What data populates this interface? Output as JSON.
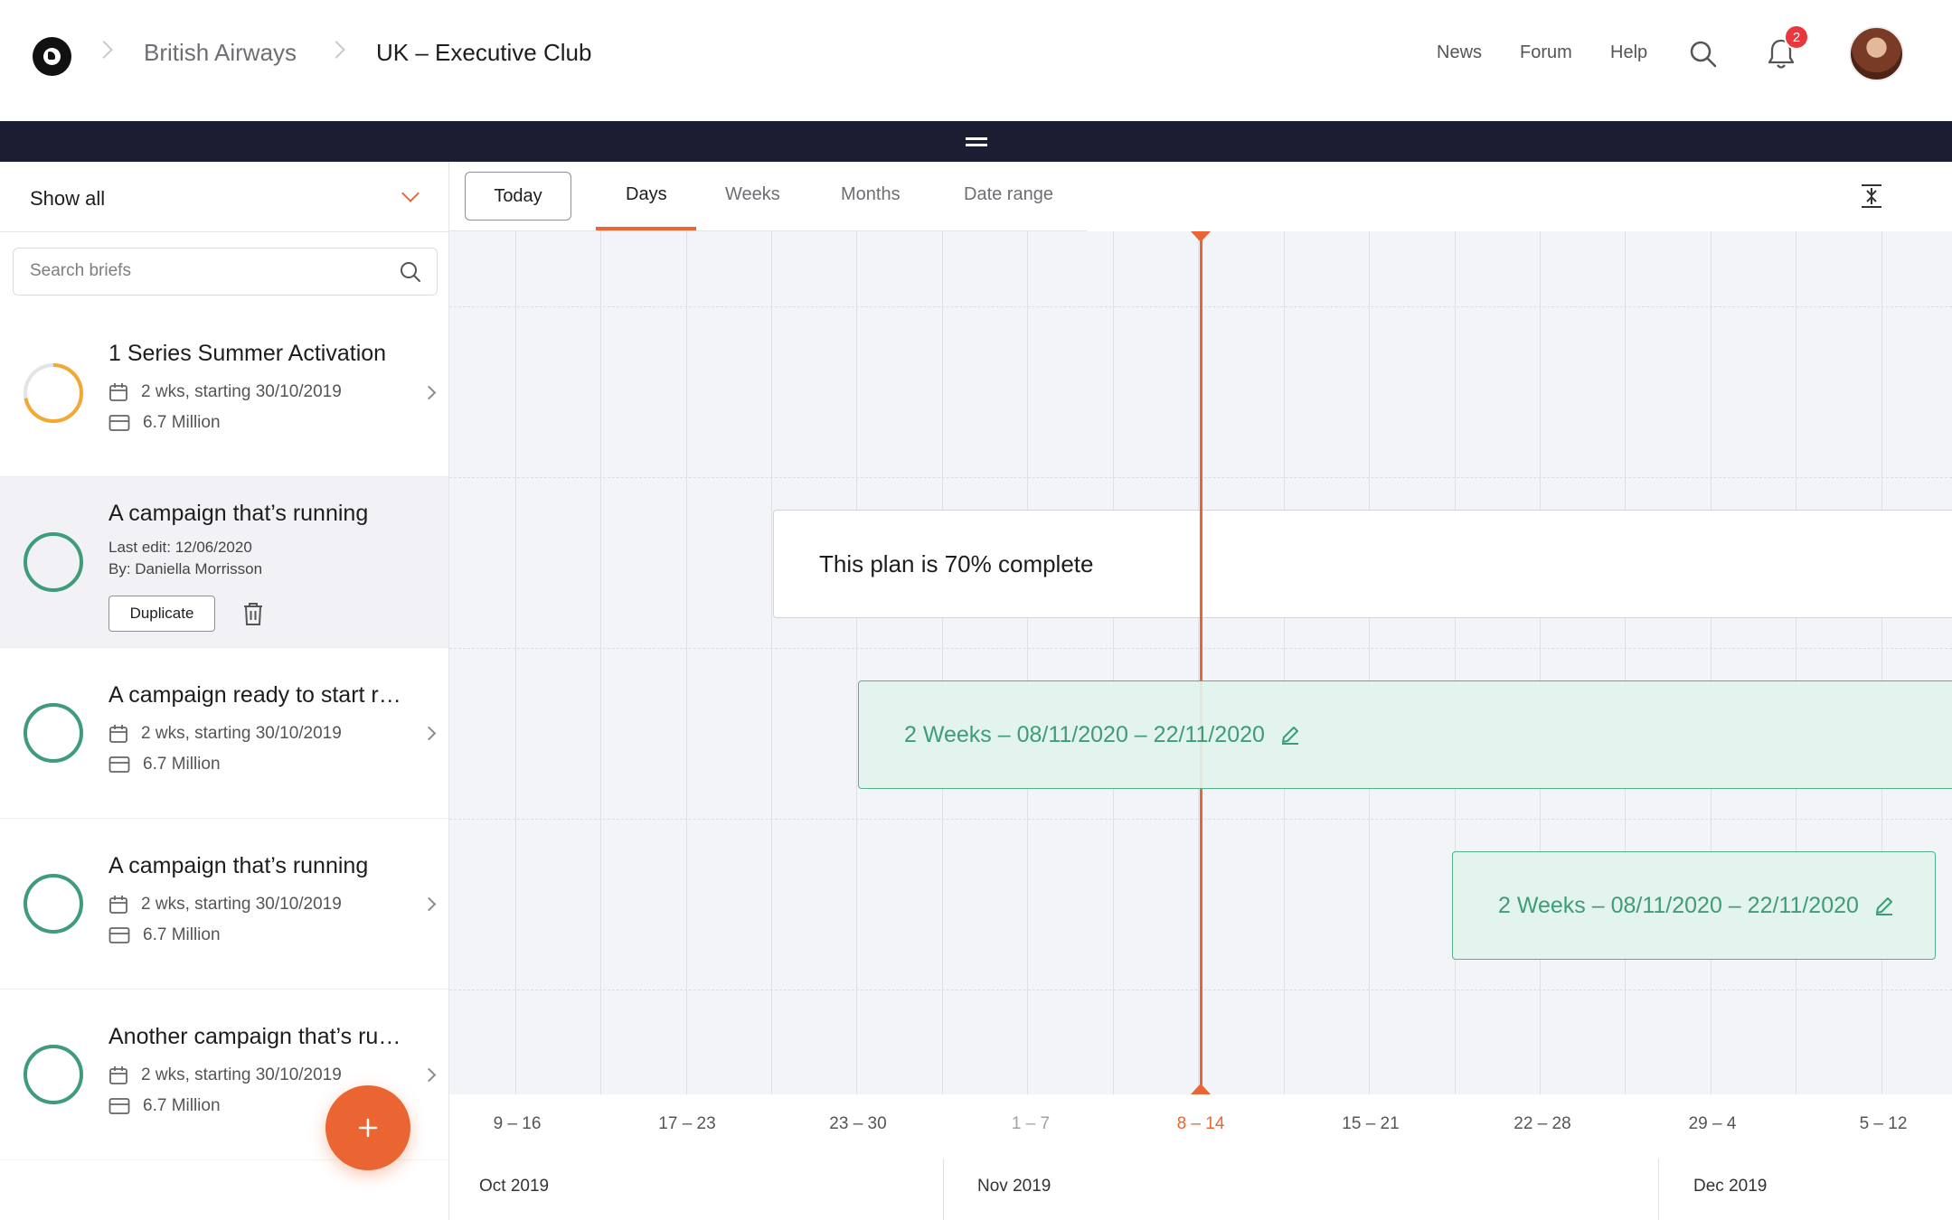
{
  "header": {
    "breadcrumb": [
      "British Airways",
      "UK – Executive Club"
    ],
    "nav": [
      "News",
      "Forum",
      "Help"
    ],
    "notification_count": "2"
  },
  "sidebar": {
    "filter_label": "Show all",
    "search_placeholder": "Search briefs",
    "briefs": [
      {
        "title": "1 Series Summer Activation",
        "duration": "2 wks, starting 30/10/2019",
        "budget": "6.7 Million",
        "progress": 0.72,
        "color": "#f2a833"
      },
      {
        "title": "A campaign that’s running",
        "last_edit": "Last edit: 12/06/2020",
        "by": "By: Daniella Morrisson",
        "duplicate_label": "Duplicate",
        "progress": 1.0,
        "color": "#3e9c78"
      },
      {
        "title": "A campaign ready to start r…",
        "duration": "2 wks, starting 30/10/2019",
        "budget": "6.7 Million",
        "progress": 1.0,
        "color": "#3e9c78"
      },
      {
        "title": "A campaign that’s running",
        "duration": "2 wks, starting 30/10/2019",
        "budget": "6.7 Million",
        "progress": 1.0,
        "color": "#3e9c78"
      },
      {
        "title": "Another campaign that’s ru…",
        "duration": "2 wks, starting 30/10/2019",
        "budget": "6.7 Million",
        "progress": 1.0,
        "color": "#3e9c78"
      }
    ]
  },
  "timeline": {
    "today_label": "Today",
    "tabs": [
      "Days",
      "Weeks",
      "Months",
      "Date range"
    ],
    "active_tab": "Days",
    "plan_text": "This plan is 70% complete",
    "bar_1_text": "2 Weeks – 08/11/2020 – 22/11/2020",
    "bar_2_text": "2 Weeks – 08/11/2020 – 22/11/2020",
    "weeks": [
      "9 – 16",
      "17 – 23",
      "23 – 30",
      "1 – 7",
      "8 – 14",
      "15 – 21",
      "22 – 28",
      "29 – 4",
      "5 – 12"
    ],
    "current_week": "8 – 14",
    "months": [
      "Oct 2019",
      "Nov 2019",
      "Dec 2019"
    ]
  },
  "colors": {
    "accent": "#ea6531",
    "success": "#3e9c78",
    "warning": "#f2a833",
    "navy": "#1b1e33"
  }
}
